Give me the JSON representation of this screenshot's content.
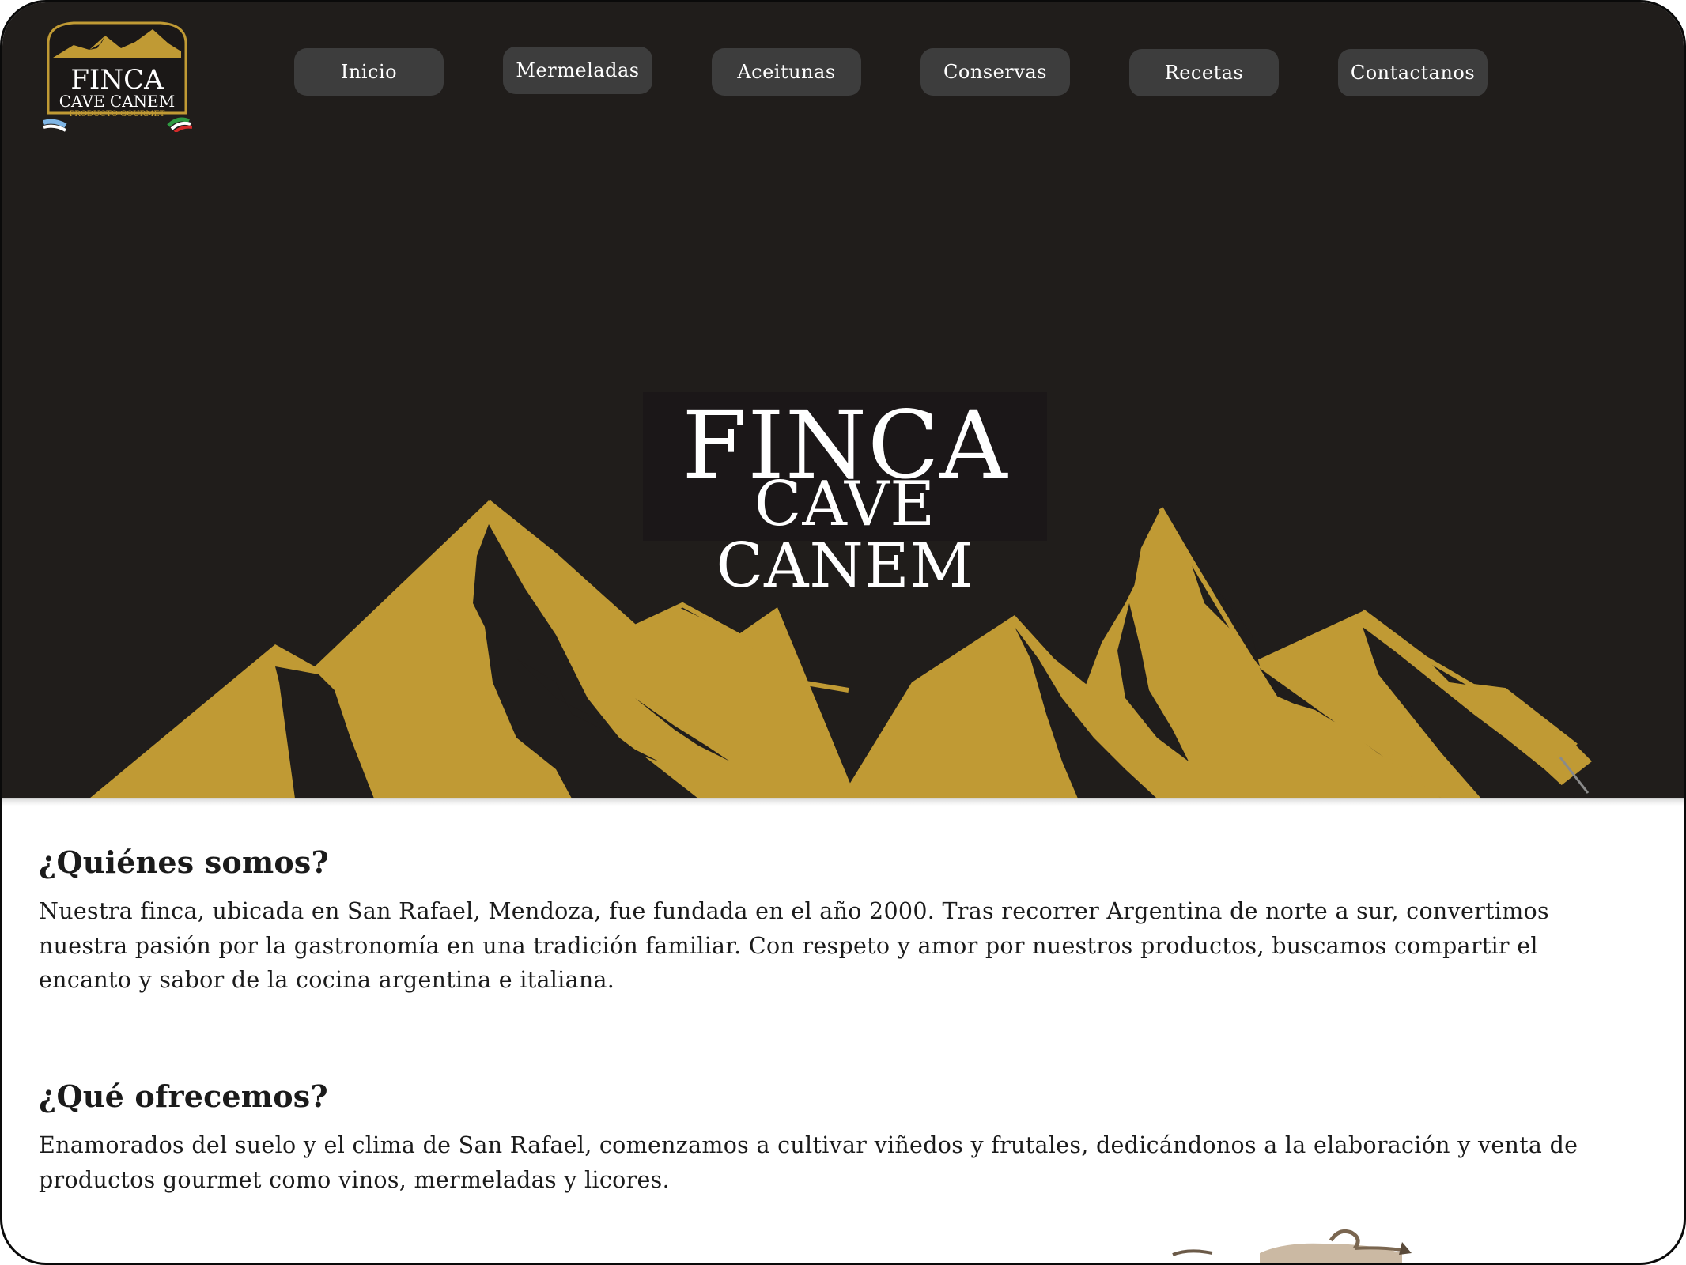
{
  "logo": {
    "line1": "FINCA",
    "line2": "CAVE CANEM",
    "line3": "PRODUCTO GOURMET",
    "gold": "#c09a34"
  },
  "nav": {
    "items": [
      {
        "label": "Inicio"
      },
      {
        "label": "Mermeladas"
      },
      {
        "label": "Aceitunas"
      },
      {
        "label": "Conservas"
      },
      {
        "label": "Recetas"
      },
      {
        "label": "Contactanos"
      }
    ]
  },
  "hero": {
    "brand_line1": "FINCA",
    "brand_line2": "CAVE CANEM",
    "background": "#201d1b",
    "mountain_color": "#c09a34"
  },
  "about": {
    "title": "¿Quiénes somos?",
    "text": "Nuestra finca, ubicada en San Rafael, Mendoza, fue fundada en el año 2000. Tras recorrer Argentina de norte a sur, convertimos nuestra pasión por la gastronomía en una tradición familiar. Con respeto y amor por nuestros productos, buscamos compartir el encanto y sabor de la cocina argentina e italiana."
  },
  "offer": {
    "title": "¿Qué ofrecemos?",
    "text": "Enamorados del suelo y el clima de San Rafael, comenzamos a cultivar viñedos y frutales, dedicándonos a la elaboración y venta de productos gourmet como vinos, mermeladas y licores."
  }
}
